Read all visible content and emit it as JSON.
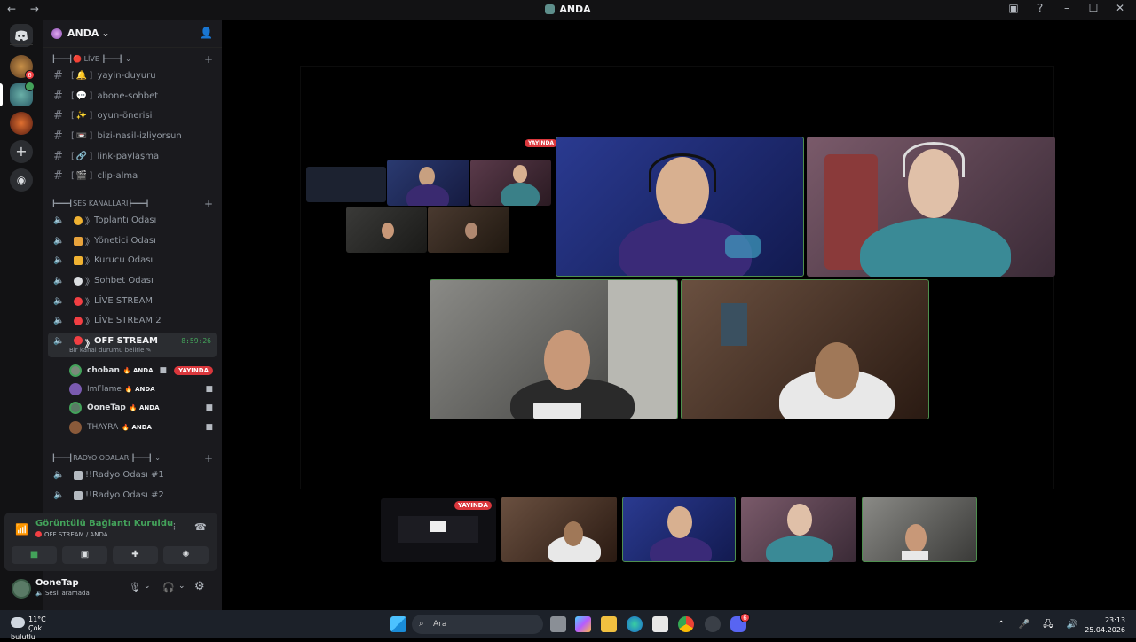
{
  "window": {
    "title": "ANDA",
    "nav": "← →",
    "controls": [
      "▣",
      "?",
      "–",
      "☐",
      "✕"
    ]
  },
  "servers": [
    {
      "name": "server-1",
      "badge": "6"
    },
    {
      "name": "server-2",
      "badge": ""
    },
    {
      "name": "server-3",
      "badge": ""
    }
  ],
  "sidebar_icons": {
    "add": "+",
    "discover": "◉"
  },
  "guild": {
    "name": "ANDA",
    "chevron": "⌄"
  },
  "categories": {
    "live": "┣━━━┫🔴 LİVE ┣━━━┫",
    "voice": "┣━━━┫SES KANALLARI┣━━━┫",
    "radio": "┣━━━┫RADYO ODALARI┣━━━┫"
  },
  "text_channels": [
    {
      "name": "yayin-duyuru",
      "emoji": "🔔"
    },
    {
      "name": "abone-sohbet",
      "emoji": "💬"
    },
    {
      "name": "oyun-önerisi",
      "emoji": "✨"
    },
    {
      "name": "bizi-nasil-izliyorsun",
      "emoji": "📼"
    },
    {
      "name": "link-paylaşma",
      "emoji": "🔗"
    },
    {
      "name": "clip-alma",
      "emoji": "🎬"
    }
  ],
  "voice_channels": [
    {
      "name": "Toplantı Odası",
      "color": "#f0b232"
    },
    {
      "name": "Yönetici Odası",
      "color": "#e8a33c"
    },
    {
      "name": "Kurucu Odası",
      "color": "#f0b232"
    },
    {
      "name": "Sohbet Odası",
      "color": "#dbdee1"
    },
    {
      "name": "LİVE STREAM",
      "color": "#f23f43"
    },
    {
      "name": "LİVE STREAM 2",
      "color": "#f23f43"
    }
  ],
  "active_channel": {
    "name": "OFF STREAM",
    "timer": "8:59:26",
    "subtitle": "Bir kanal durumu belirle"
  },
  "members": [
    {
      "name": "choban",
      "tag": "ANDA",
      "status": "YAYINDA",
      "avatar": "#7a8a7a"
    },
    {
      "name": "ImFlame",
      "tag": "ANDA",
      "status": "",
      "avatar": "#7a5ab0"
    },
    {
      "name": "OoneTap",
      "tag": "ANDA",
      "status": "",
      "avatar": "#5a7a66"
    },
    {
      "name": "THAYRA",
      "tag": "ANDA",
      "status": "",
      "avatar": "#8a5a3a"
    }
  ],
  "radio_channels": [
    {
      "name": "!!Radyo Odası #1"
    },
    {
      "name": "!!Radyo Odası #2"
    }
  ],
  "rtc": {
    "status": "Görüntülü Bağlantı Kuruldu",
    "location": "OFF STREAM / ANDA"
  },
  "user": {
    "name": "OoneTap",
    "status": "Sesli aramada"
  },
  "stage": {
    "live_badge": "YAYINDA"
  },
  "taskbar": {
    "temp": "11°C",
    "weather": "Çok bulutlu",
    "search_placeholder": "Ara",
    "time": "23:13",
    "date": "25.04.2026",
    "tray": "⌃ 🎤 🖧 🔊",
    "discord_badge": "6"
  }
}
